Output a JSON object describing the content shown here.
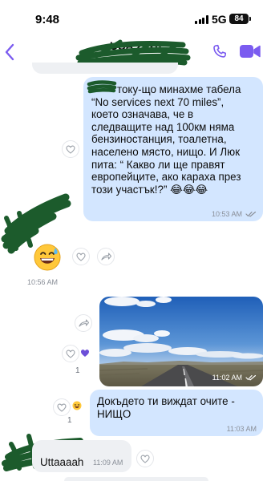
{
  "status_bar": {
    "time": "9:48",
    "network": "5G",
    "battery": "84"
  },
  "header": {
    "title": "USA 2026",
    "accent_color": "#7b5cf0"
  },
  "messages": [
    {
      "direction": "outgoing",
      "text": "току-що минахме табела\n“No services next 70 miles”,\nкоето означава, че в\nследващите над 100км няма\nбензиностанция, тоалетна,\nнаселено място, нищо. И Люк\nпита: “ Какво ли ще правят\nевропейците, ако караха през\nтози участък!?” 😂😂😂",
      "time": "10:53 AM",
      "read": true
    },
    {
      "direction": "incoming",
      "emoji": "😅",
      "time": "10:56 AM"
    },
    {
      "direction": "outgoing",
      "type": "photo",
      "photo_description": "desert highway under blue sky with clouds",
      "time": "11:02 AM",
      "read": true,
      "reaction_count": "1"
    },
    {
      "direction": "outgoing",
      "text": "Докъдето ти виждат очите -\nНИЩО",
      "time": "11:03 AM",
      "reaction_count": "1"
    },
    {
      "direction": "incoming",
      "text": "Uttaaaah",
      "time": "11:09 AM"
    }
  ]
}
